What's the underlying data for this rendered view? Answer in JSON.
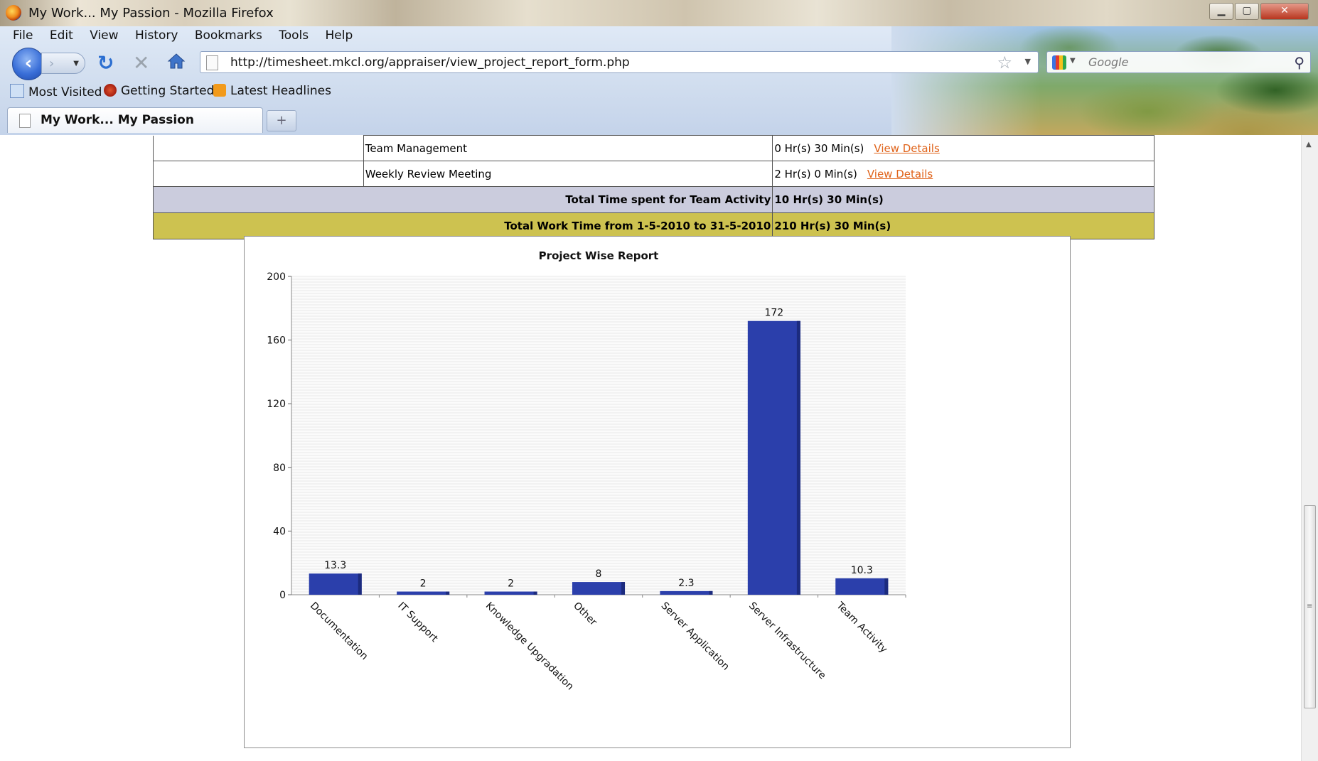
{
  "window": {
    "title": "My Work... My Passion - Mozilla Firefox",
    "controls": {
      "minimize": "▁",
      "maximize": "▢",
      "close": "✕"
    }
  },
  "menu": [
    "File",
    "Edit",
    "View",
    "History",
    "Bookmarks",
    "Tools",
    "Help"
  ],
  "nav": {
    "url": "http://timesheet.mkcl.org/appraiser/view_project_report_form.php",
    "search_placeholder": "Google"
  },
  "bookmarks": [
    "Most Visited",
    "Getting Started",
    "Latest Headlines"
  ],
  "tab": {
    "label": "My Work... My Passion",
    "new_tab": "+"
  },
  "table": {
    "rows": [
      {
        "activity": "Team Management",
        "time": "0 Hr(s) 30 Min(s)",
        "link": "View Details"
      },
      {
        "activity": "Weekly Review Meeting",
        "time": "2 Hr(s) 0 Min(s)",
        "link": "View Details"
      }
    ],
    "team_total_label": "Total Time spent for Team Activity",
    "team_total_value": "10 Hr(s) 30 Min(s)",
    "work_total_label": "Total Work Time from 1-5-2010 to 31-5-2010",
    "work_total_value": "210 Hr(s) 30 Min(s)"
  },
  "chart_data": {
    "type": "bar",
    "title": "Project Wise Report",
    "xlabel": "",
    "ylabel": "",
    "categories": [
      "Documentation",
      "IT Support",
      "Knowledge Upgradation",
      "Other",
      "Server Application",
      "Server Infrastructure",
      "Team Activity"
    ],
    "values": [
      13.3,
      2,
      2,
      8,
      2.3,
      172,
      10.3
    ],
    "value_labels": [
      "13.3",
      "2",
      "2",
      "8",
      "2.3",
      "172",
      "10.3"
    ],
    "ylim": [
      0,
      200
    ],
    "yticks": [
      0,
      40,
      80,
      120,
      160,
      200
    ],
    "grid": true,
    "legend": "none",
    "bar_color": "#2b3fab"
  }
}
